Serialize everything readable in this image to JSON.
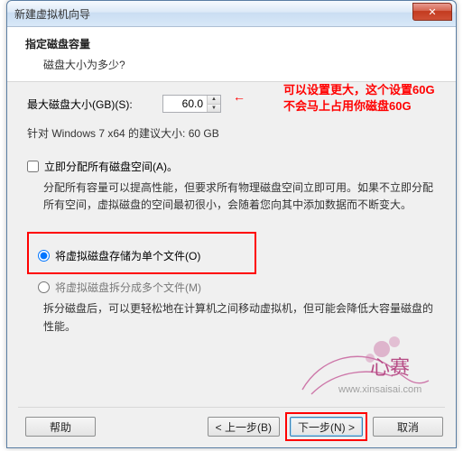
{
  "window": {
    "title": "新建虚拟机向导",
    "close_glyph": "✕"
  },
  "header": {
    "title": "指定磁盘容量",
    "subtitle": "磁盘大小为多少?"
  },
  "disk": {
    "max_label": "最大磁盘大小(GB)(S):",
    "max_value": "60.0",
    "recommended": "针对 Windows 7 x64 的建议大小: 60 GB"
  },
  "annotation": {
    "text": "可以设置更大，这个设置60G不会马上占用你磁盘60G",
    "arrow": "←"
  },
  "allocate": {
    "checkbox_label": "立即分配所有磁盘空间(A)。",
    "explain": "分配所有容量可以提高性能，但要求所有物理磁盘空间立即可用。如果不立即分配所有空间，虚拟磁盘的空间最初很小，会随着您向其中添加数据而不断变大。"
  },
  "store": {
    "single_label": "将虚拟磁盘存储为单个文件(O)",
    "split_label": "将虚拟磁盘拆分成多个文件(M)",
    "split_explain": "拆分磁盘后，可以更轻松地在计算机之间移动虚拟机，但可能会降低大容量磁盘的性能。"
  },
  "buttons": {
    "help": "帮助",
    "back": "< 上一步(B)",
    "next": "下一步(N) >",
    "cancel": "取消"
  },
  "watermark": {
    "text": "心赛",
    "url": "www.xinsaisai.com"
  }
}
